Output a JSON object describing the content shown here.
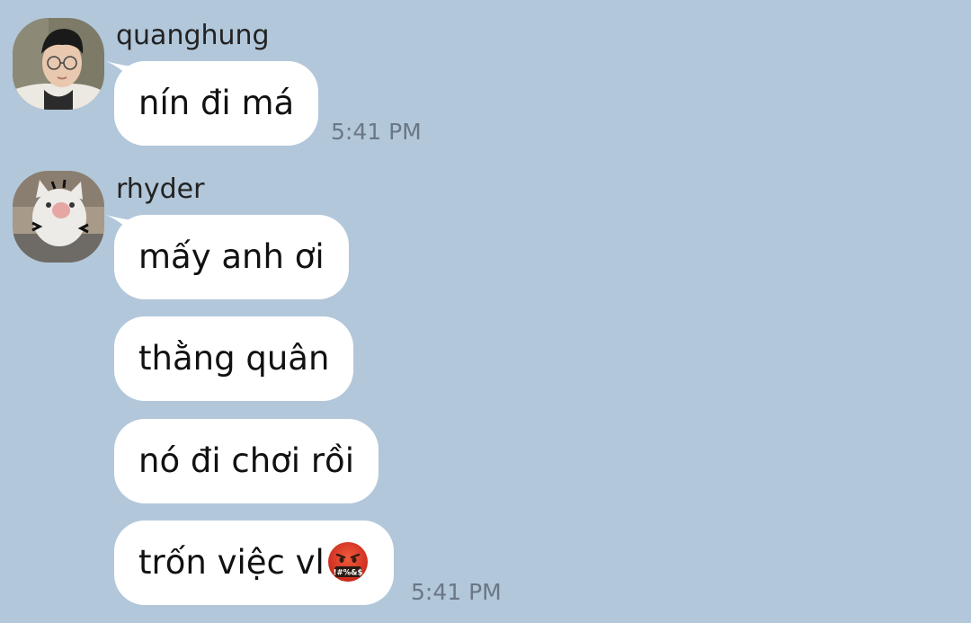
{
  "messages": [
    {
      "sender": "quanghung",
      "avatar_icon": "user-photo-avatar",
      "bubbles": [
        "nín đi má"
      ],
      "time": "5:41 PM"
    },
    {
      "sender": "rhyder",
      "avatar_icon": "cat-photo-avatar",
      "bubbles": [
        "mấy anh ơi",
        "thằng quân",
        "nó đi chơi rồi",
        "trốn việc vl"
      ],
      "emoji": "face-with-symbols-on-mouth-icon",
      "time": "5:41 PM"
    }
  ],
  "colors": {
    "background": "#b2c7da",
    "bubble": "#ffffff",
    "timestamp": "#6b7785"
  }
}
